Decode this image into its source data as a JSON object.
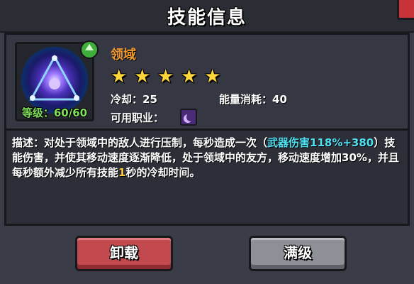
{
  "dialog": {
    "title": "技能信息"
  },
  "skill": {
    "name": "领域",
    "stars": 5,
    "star_glyph": "★",
    "level_label": "等级：60/60",
    "cooldown_label": "冷却：",
    "cooldown_value": "25",
    "energy_label": "能量消耗：",
    "energy_value": "40",
    "profession_label": "可用职业：",
    "icon": "domain-skill-icon",
    "profession_icon": "wizard-moon-icon"
  },
  "description": {
    "prefix": "描述：对处于领域中的敌人进行压制，每秒造成一次（",
    "highlight": "武器伤害118%+380",
    "middle": "）技能伤害，并使其移动速度逐渐降低，处于领域中的友方，移动速度增加30%，并且每秒额外减少所有技能",
    "number": "1",
    "suffix": "秒的冷却时间。"
  },
  "buttons": {
    "unequip_label": "卸载",
    "max_label": "满级"
  },
  "colors": {
    "name": "#f29a2e",
    "level": "#7ee05a",
    "highlight": "#4fe0f2",
    "number": "#ffcf3a",
    "unequip": "#c24a4f",
    "max": "#8e9097"
  }
}
